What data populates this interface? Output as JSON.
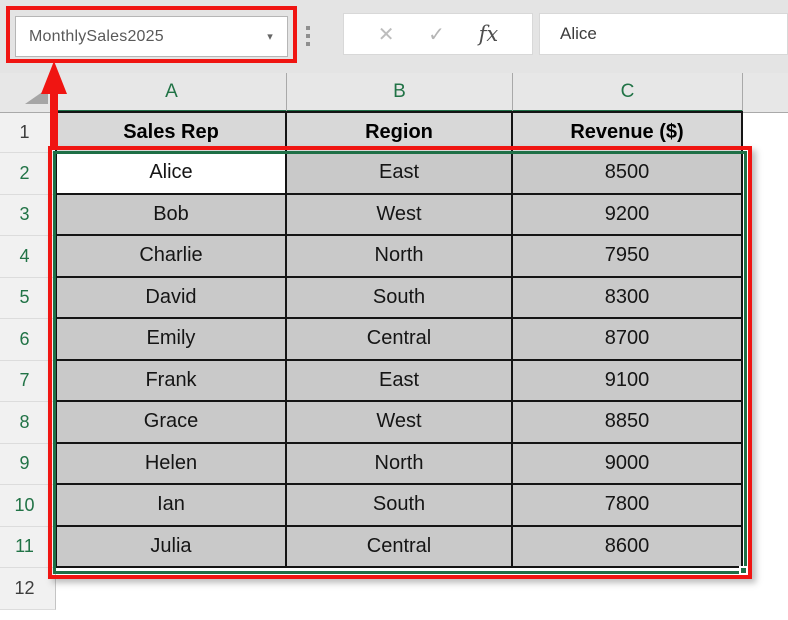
{
  "name_box": {
    "value": "MonthlySales2025"
  },
  "icons": {
    "dropdown": "▾",
    "cancel": "✕",
    "enter": "✓",
    "function": "fx"
  },
  "formula_bar": {
    "value": "Alice"
  },
  "grid": {
    "column_headers": [
      "A",
      "B",
      "C"
    ],
    "row_numbers": [
      "1",
      "2",
      "3",
      "4",
      "5",
      "6",
      "7",
      "8",
      "9",
      "10",
      "11",
      "12"
    ],
    "header_row": [
      "Sales Rep",
      "Region",
      "Revenue ($)"
    ],
    "rows": [
      [
        "Alice",
        "East",
        "8500"
      ],
      [
        "Bob",
        "West",
        "9200"
      ],
      [
        "Charlie",
        "North",
        "7950"
      ],
      [
        "David",
        "South",
        "8300"
      ],
      [
        "Emily",
        "Central",
        "8700"
      ],
      [
        "Frank",
        "East",
        "9100"
      ],
      [
        "Grace",
        "West",
        "8850"
      ],
      [
        "Helen",
        "North",
        "9000"
      ],
      [
        "Ian",
        "South",
        "7800"
      ],
      [
        "Julia",
        "Central",
        "8600"
      ]
    ]
  },
  "colors": {
    "annotation_red": "#f01512",
    "selection_green": "#1e6f46",
    "header_text_green": "#217346"
  }
}
